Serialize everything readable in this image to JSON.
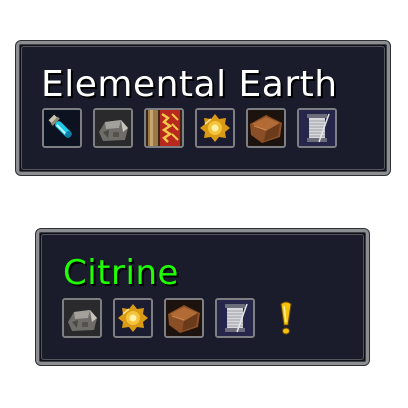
{
  "tooltips": [
    {
      "title": "Elemental Earth",
      "title_color": "#ffffff",
      "icons": [
        "potion-vial-icon",
        "anvil-ore-icon",
        "pillar-scroll-icon",
        "gear-gem-icon",
        "leather-hide-icon",
        "thread-spool-icon"
      ]
    },
    {
      "title": "Citrine",
      "title_color": "#1eff00",
      "icons": [
        "anvil-ore-icon",
        "gear-gem-icon",
        "leather-hide-icon",
        "thread-spool-icon",
        "exclamation-icon"
      ]
    }
  ]
}
